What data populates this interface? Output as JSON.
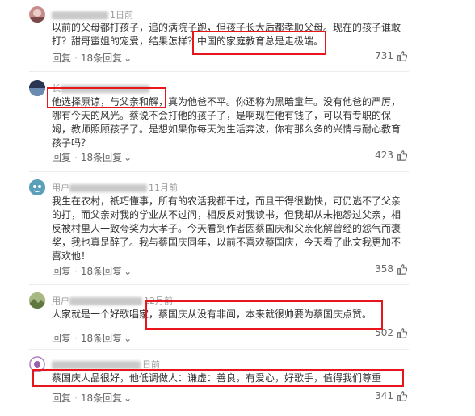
{
  "comments": [
    {
      "user": "1日前",
      "lines": [
        "以前的父母都打孩子，追的满院子跑，但孩子长大后都孝顺父母。现在的孩子谁敢",
        "打？甜哥蜜姐的宠爱，结果怎样？中国的家庭教育总是走极端。"
      ],
      "reply": "回复",
      "replies_count": "18条回复",
      "likes": "731"
    },
    {
      "user": "长",
      "lines": [
        "他选择原谅，与父亲和解，真为他爸不平。你还称为黑暗童年。没有他爸的严厉，",
        "哪有今天的风光。蔡说不会打他的孩子了，是啊现在他有钱了，可以有专职的保",
        "姆，教师照顾孩子了。是想如果你每天为生活奔波，你有那么多的兴情与耐心教育",
        "孩子吗？"
      ],
      "reply": "回复",
      "replies_count": "18条回复",
      "likes": "423"
    },
    {
      "user": "用户",
      "user_tail": "11月前",
      "lines": [
        "我生在农村，祇巧懂事，所有的农活我都干过，而且干得很勤快，可仍逃不了父亲",
        "的打，而父亲对我的学业从不过问，相反反对我读书，但我却从未抱怨过父亲，相",
        "反被村里人一致夸奖为大孝子。今天看到作者因蔡国庆和父亲化解曾经的怨气而褒",
        "奖，我也真是醉了。我与蔡国庆同年，以前不喜欢蔡国庆，今天看了此文我更加不",
        "喜欢他！"
      ],
      "reply": "回复",
      "replies_count": "18条回复",
      "likes": "358"
    },
    {
      "user": "用户",
      "user_tail": "12月前",
      "lines": [
        "人家就是一个好歌唱家，蔡国庆从没有非闻，本来就很帅要为蔡国庆点赞。"
      ],
      "reply": "回复",
      "replies_count": "18条回复",
      "likes": "502"
    },
    {
      "user": "",
      "user_tail": "日前",
      "lines": [
        "蔡国庆人品很好，他低调做人：谦虚：善良，有爱心，好歌手，值得我们尊重"
      ],
      "reply": "回复",
      "replies_count": "18条回复",
      "likes": "341"
    }
  ],
  "colors": {
    "highlight": "#e8161c",
    "text": "#333333",
    "meta": "#666666"
  }
}
